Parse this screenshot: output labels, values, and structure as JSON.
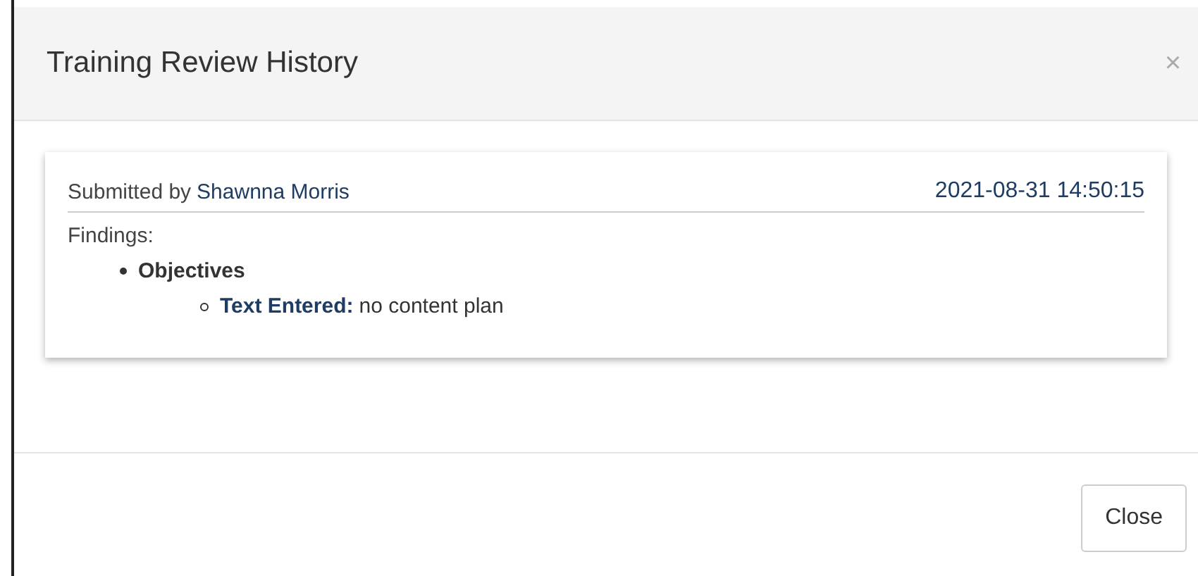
{
  "dialog": {
    "title": "Training Review History",
    "close_glyph": "×",
    "entry": {
      "submitted_label": "Submitted by",
      "submitter": "Shawnna Morris",
      "timestamp": "2021-08-31 14:50:15",
      "findings_label": "Findings:",
      "findings": [
        {
          "name": "Objectives",
          "children": [
            {
              "label": "Text Entered:",
              "value": "no content plan"
            }
          ]
        }
      ]
    },
    "buttons": [
      "Close"
    ]
  }
}
